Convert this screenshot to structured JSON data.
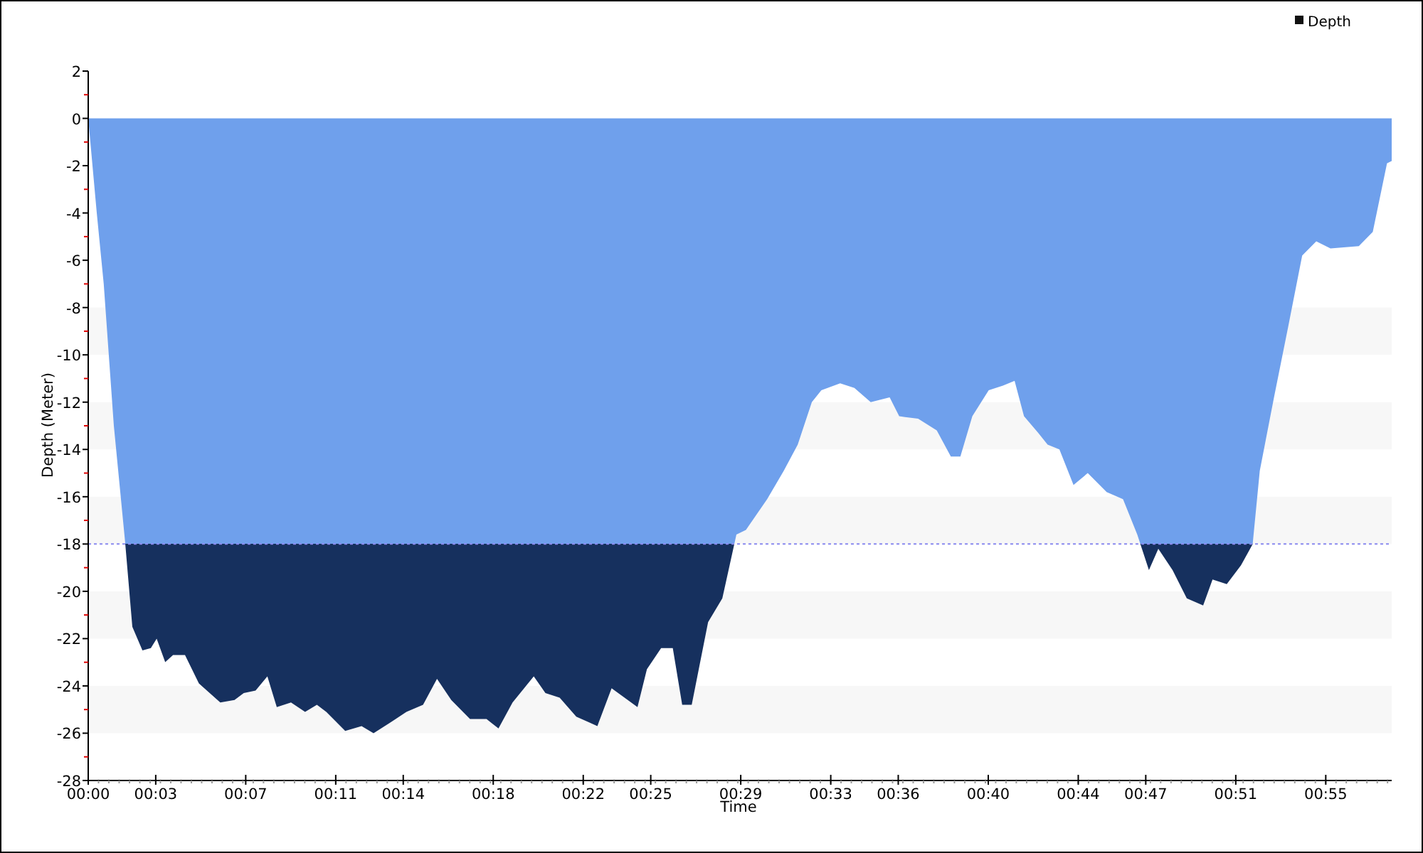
{
  "chart_data": {
    "type": "area",
    "xlabel": "Time",
    "ylabel": "Depth (Meter)",
    "x": [
      0,
      0.38,
      0.69,
      1.14,
      1.64,
      1.96,
      2.41,
      2.78,
      3.04,
      3.42,
      3.77,
      4.3,
      4.92,
      5.87,
      6.5,
      6.91,
      7.44,
      7.96,
      8.38,
      9.01,
      9.64,
      10.16,
      10.58,
      11.42,
      12.15,
      12.68,
      13.51,
      14.14,
      14.88,
      15.5,
      16.13,
      16.97,
      17.7,
      18.23,
      18.86,
      19.8,
      20.32,
      20.95,
      21.69,
      22.63,
      23.26,
      24.41,
      24.83,
      25.46,
      25.98,
      26.4,
      26.82,
      27.55,
      28.18,
      28.81,
      29.23,
      30.17,
      30.91,
      31.53,
      32.16,
      32.58,
      33.42,
      34.05,
      34.78,
      35.62,
      36.04,
      36.88,
      37.71,
      38.34,
      38.76,
      39.29,
      40.02,
      40.65,
      41.17,
      41.59,
      42.22,
      42.64,
      43.16,
      43.79,
      44.42,
      45.26,
      45.99,
      46.62,
      47.14,
      47.56,
      48.19,
      48.82,
      49.55,
      49.97,
      50.6,
      51.23,
      51.75,
      52.07,
      52.7,
      53.33,
      53.95,
      54.58,
      55.21,
      56.47,
      57.09,
      57.72,
      57.93
    ],
    "series": [
      {
        "name": "Depth",
        "color": "#6fa0ec",
        "values": [
          0,
          -4,
          -7,
          -13,
          -17.9,
          -21.5,
          -22.5,
          -22.4,
          -22,
          -23,
          -22.7,
          -22.7,
          -23.9,
          -24.7,
          -24.6,
          -24.3,
          -24.2,
          -23.6,
          -24.9,
          -24.7,
          -25.1,
          -24.8,
          -25.1,
          -25.9,
          -25.7,
          -26,
          -25.5,
          -25.1,
          -24.8,
          -23.7,
          -24.6,
          -25.4,
          -25.4,
          -25.8,
          -24.7,
          -23.6,
          -24.3,
          -24.5,
          -25.3,
          -25.7,
          -24.1,
          -24.9,
          -23.3,
          -22.4,
          -22.4,
          -24.8,
          -24.8,
          -21.3,
          -20.3,
          -17.6,
          -17.4,
          -16.1,
          -14.9,
          -13.8,
          -12,
          -11.5,
          -11.2,
          -11.4,
          -12,
          -11.8,
          -12.6,
          -12.7,
          -13.2,
          -14.3,
          -14.3,
          -12.6,
          -11.5,
          -11.3,
          -11.1,
          -12.6,
          -13.3,
          -13.8,
          -14,
          -15.5,
          -15,
          -15.8,
          -16.1,
          -17.6,
          -19.1,
          -18.2,
          -19.1,
          -20.3,
          -20.6,
          -19.5,
          -19.7,
          -18.9,
          -18,
          -14.9,
          -11.8,
          -8.8,
          -5.8,
          -5.2,
          -5.5,
          -5.4,
          -4.8,
          -1.9,
          -1.8
        ]
      }
    ],
    "xlim": [
      0,
      57.93
    ],
    "ylim": [
      -28,
      2
    ],
    "xticks": [
      {
        "value": 0,
        "label": "00:00"
      },
      {
        "value": 3,
        "label": "00:03"
      },
      {
        "value": 7,
        "label": "00:07"
      },
      {
        "value": 11,
        "label": "00:11"
      },
      {
        "value": 14,
        "label": "00:14"
      },
      {
        "value": 18,
        "label": "00:18"
      },
      {
        "value": 22,
        "label": "00:22"
      },
      {
        "value": 25,
        "label": "00:25"
      },
      {
        "value": 29,
        "label": "00:29"
      },
      {
        "value": 33,
        "label": "00:33"
      },
      {
        "value": 36,
        "label": "00:36"
      },
      {
        "value": 40,
        "label": "00:40"
      },
      {
        "value": 44,
        "label": "00:44"
      },
      {
        "value": 47,
        "label": "00:47"
      },
      {
        "value": 51,
        "label": "00:51"
      },
      {
        "value": 55,
        "label": "00:55"
      }
    ],
    "yticks": [
      2,
      0,
      -2,
      -4,
      -6,
      -8,
      -10,
      -12,
      -14,
      -16,
      -18,
      -20,
      -22,
      -24,
      -26,
      -28
    ],
    "ref_lines": [
      {
        "axis": "y",
        "value": -18,
        "color": "#8a8af0"
      }
    ]
  }
}
